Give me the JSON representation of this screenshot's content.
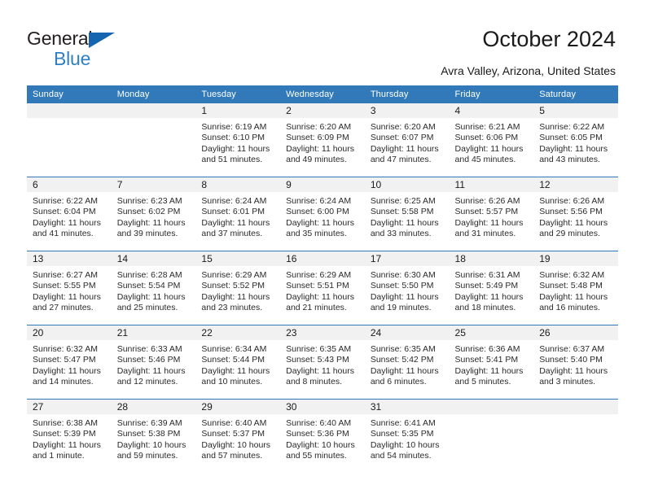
{
  "brand": {
    "name_line1": "General",
    "name_line2": "Blue",
    "triangle_color": "#1565b0",
    "blue_text_color": "#2e7fc4"
  },
  "header": {
    "title": "October 2024",
    "location": "Avra Valley, Arizona, United States"
  },
  "theme": {
    "header_bg": "#3179b8",
    "daynum_bg": "#f1f1f1",
    "row_rule": "#3179b8"
  },
  "weekdays": [
    "Sunday",
    "Monday",
    "Tuesday",
    "Wednesday",
    "Thursday",
    "Friday",
    "Saturday"
  ],
  "weeks": [
    [
      {
        "empty": true,
        "day": "",
        "sunrise": "",
        "sunset": "",
        "daylight1": "",
        "daylight2": ""
      },
      {
        "empty": true,
        "day": "",
        "sunrise": "",
        "sunset": "",
        "daylight1": "",
        "daylight2": ""
      },
      {
        "empty": false,
        "day": "1",
        "sunrise": "Sunrise: 6:19 AM",
        "sunset": "Sunset: 6:10 PM",
        "daylight1": "Daylight: 11 hours",
        "daylight2": "and 51 minutes."
      },
      {
        "empty": false,
        "day": "2",
        "sunrise": "Sunrise: 6:20 AM",
        "sunset": "Sunset: 6:09 PM",
        "daylight1": "Daylight: 11 hours",
        "daylight2": "and 49 minutes."
      },
      {
        "empty": false,
        "day": "3",
        "sunrise": "Sunrise: 6:20 AM",
        "sunset": "Sunset: 6:07 PM",
        "daylight1": "Daylight: 11 hours",
        "daylight2": "and 47 minutes."
      },
      {
        "empty": false,
        "day": "4",
        "sunrise": "Sunrise: 6:21 AM",
        "sunset": "Sunset: 6:06 PM",
        "daylight1": "Daylight: 11 hours",
        "daylight2": "and 45 minutes."
      },
      {
        "empty": false,
        "day": "5",
        "sunrise": "Sunrise: 6:22 AM",
        "sunset": "Sunset: 6:05 PM",
        "daylight1": "Daylight: 11 hours",
        "daylight2": "and 43 minutes."
      }
    ],
    [
      {
        "empty": false,
        "day": "6",
        "sunrise": "Sunrise: 6:22 AM",
        "sunset": "Sunset: 6:04 PM",
        "daylight1": "Daylight: 11 hours",
        "daylight2": "and 41 minutes."
      },
      {
        "empty": false,
        "day": "7",
        "sunrise": "Sunrise: 6:23 AM",
        "sunset": "Sunset: 6:02 PM",
        "daylight1": "Daylight: 11 hours",
        "daylight2": "and 39 minutes."
      },
      {
        "empty": false,
        "day": "8",
        "sunrise": "Sunrise: 6:24 AM",
        "sunset": "Sunset: 6:01 PM",
        "daylight1": "Daylight: 11 hours",
        "daylight2": "and 37 minutes."
      },
      {
        "empty": false,
        "day": "9",
        "sunrise": "Sunrise: 6:24 AM",
        "sunset": "Sunset: 6:00 PM",
        "daylight1": "Daylight: 11 hours",
        "daylight2": "and 35 minutes."
      },
      {
        "empty": false,
        "day": "10",
        "sunrise": "Sunrise: 6:25 AM",
        "sunset": "Sunset: 5:58 PM",
        "daylight1": "Daylight: 11 hours",
        "daylight2": "and 33 minutes."
      },
      {
        "empty": false,
        "day": "11",
        "sunrise": "Sunrise: 6:26 AM",
        "sunset": "Sunset: 5:57 PM",
        "daylight1": "Daylight: 11 hours",
        "daylight2": "and 31 minutes."
      },
      {
        "empty": false,
        "day": "12",
        "sunrise": "Sunrise: 6:26 AM",
        "sunset": "Sunset: 5:56 PM",
        "daylight1": "Daylight: 11 hours",
        "daylight2": "and 29 minutes."
      }
    ],
    [
      {
        "empty": false,
        "day": "13",
        "sunrise": "Sunrise: 6:27 AM",
        "sunset": "Sunset: 5:55 PM",
        "daylight1": "Daylight: 11 hours",
        "daylight2": "and 27 minutes."
      },
      {
        "empty": false,
        "day": "14",
        "sunrise": "Sunrise: 6:28 AM",
        "sunset": "Sunset: 5:54 PM",
        "daylight1": "Daylight: 11 hours",
        "daylight2": "and 25 minutes."
      },
      {
        "empty": false,
        "day": "15",
        "sunrise": "Sunrise: 6:29 AM",
        "sunset": "Sunset: 5:52 PM",
        "daylight1": "Daylight: 11 hours",
        "daylight2": "and 23 minutes."
      },
      {
        "empty": false,
        "day": "16",
        "sunrise": "Sunrise: 6:29 AM",
        "sunset": "Sunset: 5:51 PM",
        "daylight1": "Daylight: 11 hours",
        "daylight2": "and 21 minutes."
      },
      {
        "empty": false,
        "day": "17",
        "sunrise": "Sunrise: 6:30 AM",
        "sunset": "Sunset: 5:50 PM",
        "daylight1": "Daylight: 11 hours",
        "daylight2": "and 19 minutes."
      },
      {
        "empty": false,
        "day": "18",
        "sunrise": "Sunrise: 6:31 AM",
        "sunset": "Sunset: 5:49 PM",
        "daylight1": "Daylight: 11 hours",
        "daylight2": "and 18 minutes."
      },
      {
        "empty": false,
        "day": "19",
        "sunrise": "Sunrise: 6:32 AM",
        "sunset": "Sunset: 5:48 PM",
        "daylight1": "Daylight: 11 hours",
        "daylight2": "and 16 minutes."
      }
    ],
    [
      {
        "empty": false,
        "day": "20",
        "sunrise": "Sunrise: 6:32 AM",
        "sunset": "Sunset: 5:47 PM",
        "daylight1": "Daylight: 11 hours",
        "daylight2": "and 14 minutes."
      },
      {
        "empty": false,
        "day": "21",
        "sunrise": "Sunrise: 6:33 AM",
        "sunset": "Sunset: 5:46 PM",
        "daylight1": "Daylight: 11 hours",
        "daylight2": "and 12 minutes."
      },
      {
        "empty": false,
        "day": "22",
        "sunrise": "Sunrise: 6:34 AM",
        "sunset": "Sunset: 5:44 PM",
        "daylight1": "Daylight: 11 hours",
        "daylight2": "and 10 minutes."
      },
      {
        "empty": false,
        "day": "23",
        "sunrise": "Sunrise: 6:35 AM",
        "sunset": "Sunset: 5:43 PM",
        "daylight1": "Daylight: 11 hours",
        "daylight2": "and 8 minutes."
      },
      {
        "empty": false,
        "day": "24",
        "sunrise": "Sunrise: 6:35 AM",
        "sunset": "Sunset: 5:42 PM",
        "daylight1": "Daylight: 11 hours",
        "daylight2": "and 6 minutes."
      },
      {
        "empty": false,
        "day": "25",
        "sunrise": "Sunrise: 6:36 AM",
        "sunset": "Sunset: 5:41 PM",
        "daylight1": "Daylight: 11 hours",
        "daylight2": "and 5 minutes."
      },
      {
        "empty": false,
        "day": "26",
        "sunrise": "Sunrise: 6:37 AM",
        "sunset": "Sunset: 5:40 PM",
        "daylight1": "Daylight: 11 hours",
        "daylight2": "and 3 minutes."
      }
    ],
    [
      {
        "empty": false,
        "day": "27",
        "sunrise": "Sunrise: 6:38 AM",
        "sunset": "Sunset: 5:39 PM",
        "daylight1": "Daylight: 11 hours",
        "daylight2": "and 1 minute."
      },
      {
        "empty": false,
        "day": "28",
        "sunrise": "Sunrise: 6:39 AM",
        "sunset": "Sunset: 5:38 PM",
        "daylight1": "Daylight: 10 hours",
        "daylight2": "and 59 minutes."
      },
      {
        "empty": false,
        "day": "29",
        "sunrise": "Sunrise: 6:40 AM",
        "sunset": "Sunset: 5:37 PM",
        "daylight1": "Daylight: 10 hours",
        "daylight2": "and 57 minutes."
      },
      {
        "empty": false,
        "day": "30",
        "sunrise": "Sunrise: 6:40 AM",
        "sunset": "Sunset: 5:36 PM",
        "daylight1": "Daylight: 10 hours",
        "daylight2": "and 55 minutes."
      },
      {
        "empty": false,
        "day": "31",
        "sunrise": "Sunrise: 6:41 AM",
        "sunset": "Sunset: 5:35 PM",
        "daylight1": "Daylight: 10 hours",
        "daylight2": "and 54 minutes."
      },
      {
        "empty": true,
        "day": "",
        "sunrise": "",
        "sunset": "",
        "daylight1": "",
        "daylight2": ""
      },
      {
        "empty": true,
        "day": "",
        "sunrise": "",
        "sunset": "",
        "daylight1": "",
        "daylight2": ""
      }
    ]
  ]
}
